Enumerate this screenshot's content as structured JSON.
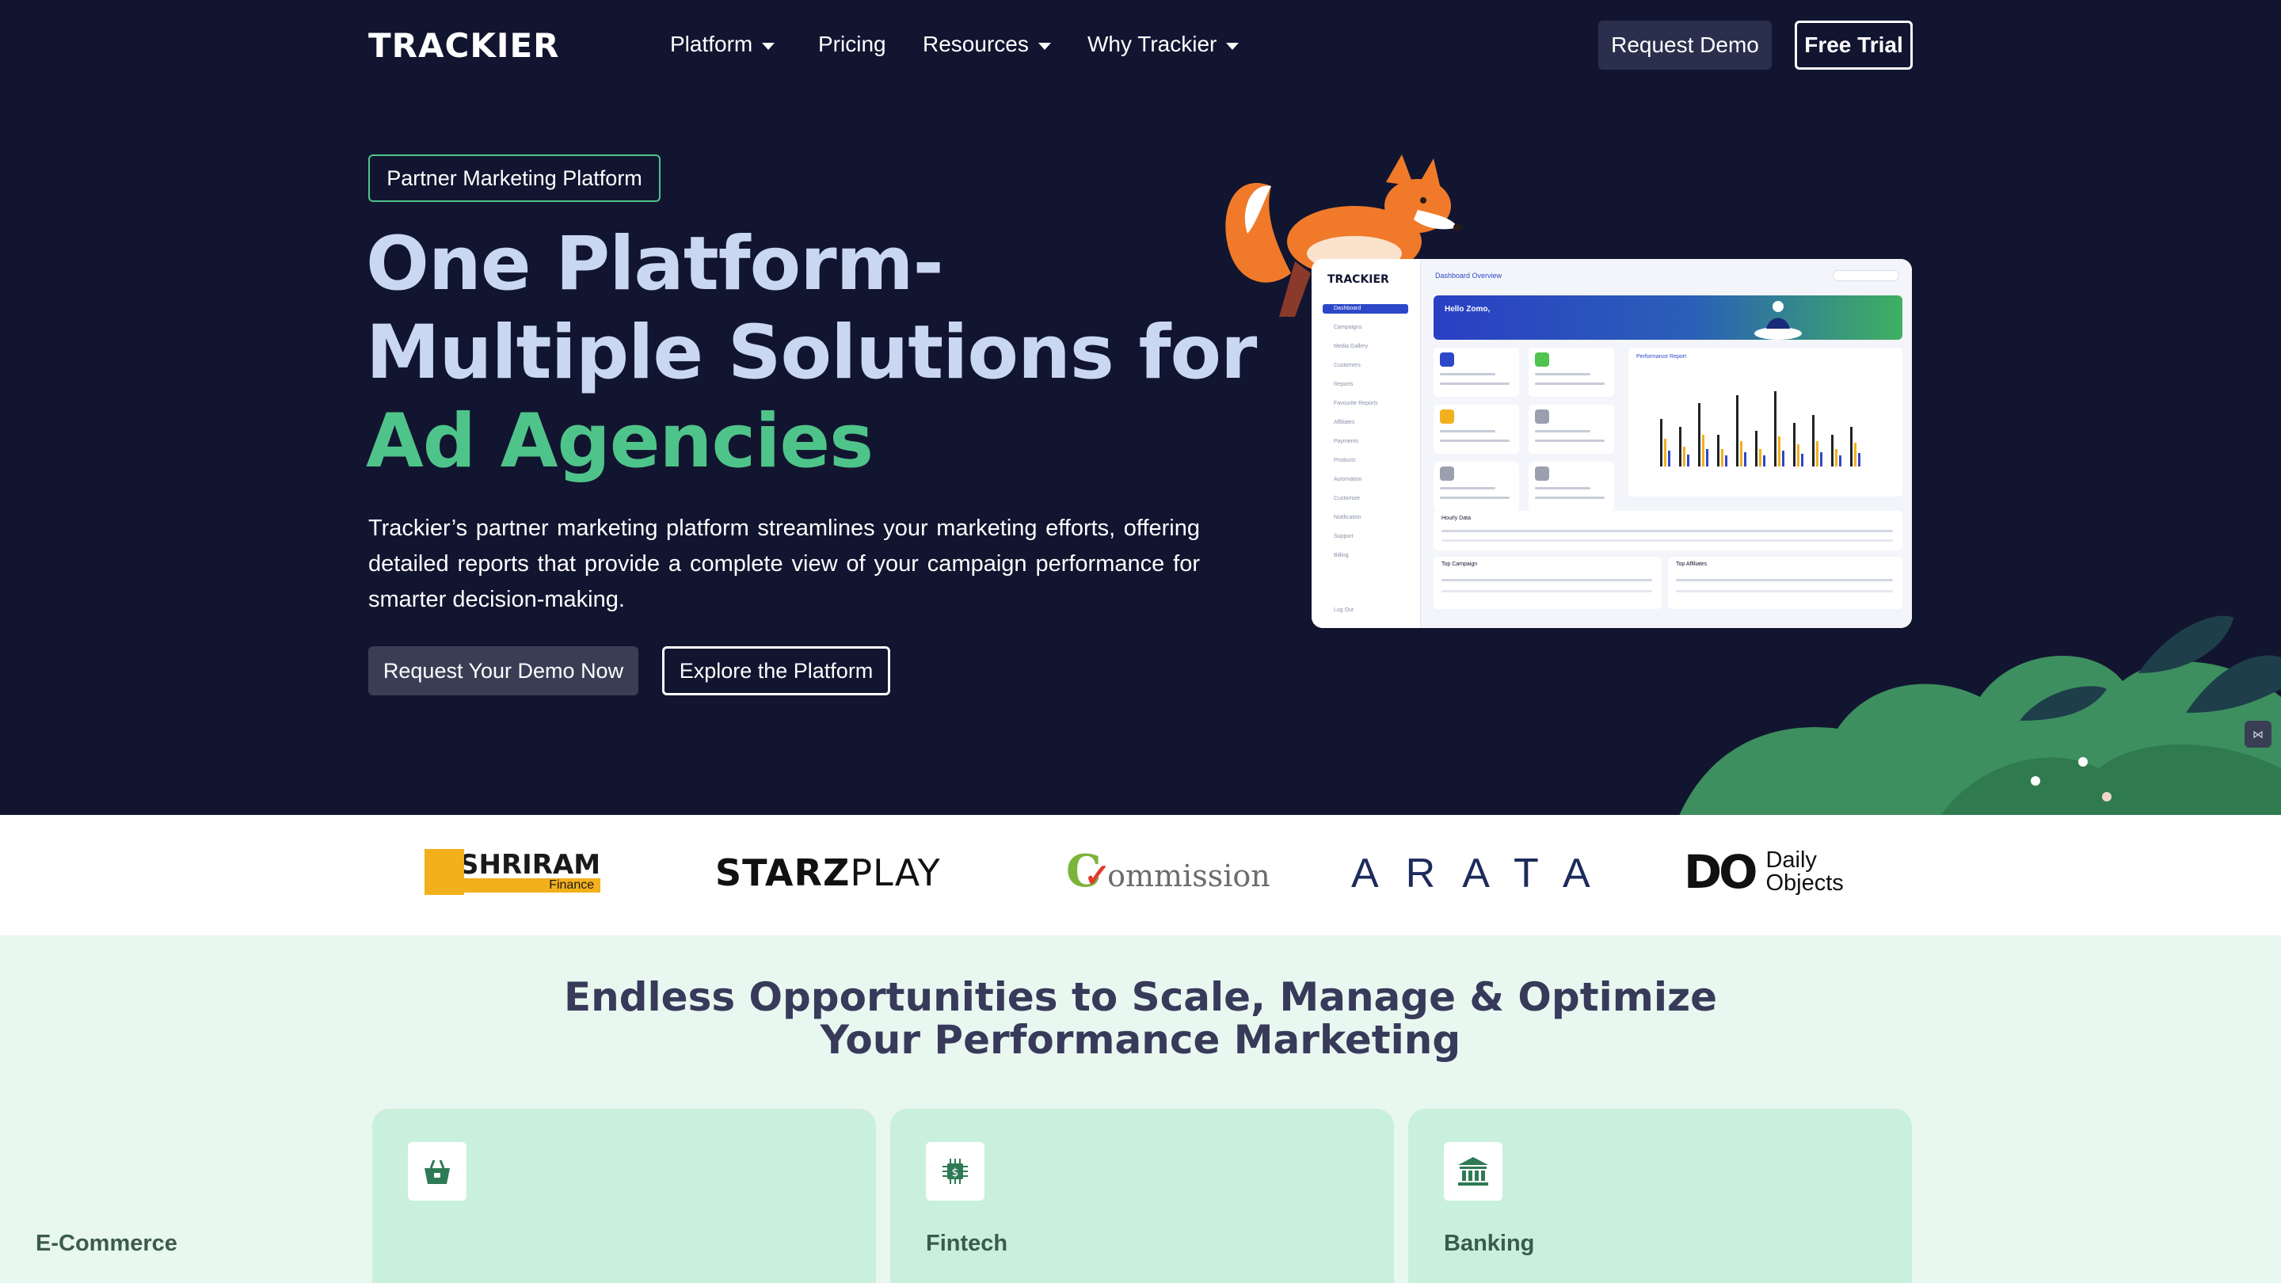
{
  "header": {
    "logo": "TRACKIER",
    "nav": [
      {
        "label": "Platform",
        "dropdown": true
      },
      {
        "label": "Pricing",
        "dropdown": false
      },
      {
        "label": "Resources",
        "dropdown": true
      },
      {
        "label": "Why Trackier",
        "dropdown": true
      }
    ],
    "request_demo": "Request Demo",
    "free_trial": "Free Trial"
  },
  "hero": {
    "badge": "Partner Marketing Platform",
    "headline_line1": "One Platform-",
    "headline_line2": "Multiple Solutions for",
    "headline_line3": "Ad Agencies",
    "description": "Trackier’s partner marketing platform streamlines your marketing efforts, offering detailed reports that provide a complete view of your campaign performance for smarter decision-making.",
    "cta_primary": "Request Your Demo Now",
    "cta_secondary": "Explore the Platform"
  },
  "dashboard_preview": {
    "logo": "TRACKIER",
    "title": "Dashboard Overview",
    "greeting": "Hello Zomo,",
    "sidebar": [
      "Dashboard",
      "Campaigns",
      "Media Gallery",
      "Customers",
      "Reports",
      "Favourite Reports",
      "Affiliates",
      "Payments",
      "Products",
      "Automation",
      "Customize",
      "Notification",
      "Support",
      "Billing"
    ],
    "logout": "Log Out",
    "chart_title": "Performance Report",
    "hourly": "Hourly Data",
    "top_campaign": "Top Campaign",
    "top_affiliates": "Top Affiliates"
  },
  "brands": {
    "shriram": "SHRIRAM",
    "shriram_sub": "Finance",
    "starz_bold": "STARZ",
    "starz_light": "PLAY",
    "commission": "ommission",
    "arata": "ARATA",
    "daily_mark": "DO",
    "daily_line1": "Daily",
    "daily_line2": "Objects"
  },
  "opportunities": {
    "title_line1": "Endless Opportunities to Scale, Manage & Optimize",
    "title_line2": "Your Performance Marketing",
    "cards": [
      {
        "label": "E-Commerce",
        "icon": "shopping-basket-icon"
      },
      {
        "label": "Fintech",
        "icon": "fintech-chip-icon"
      },
      {
        "label": "Banking",
        "icon": "bank-icon"
      }
    ]
  },
  "colors": {
    "hero_bg": "#121530",
    "accent_green": "#4fc48a",
    "headline_blue": "#c9d7f2",
    "section_bg": "#e8f7f0",
    "card_bg": "#c9f0dc"
  }
}
